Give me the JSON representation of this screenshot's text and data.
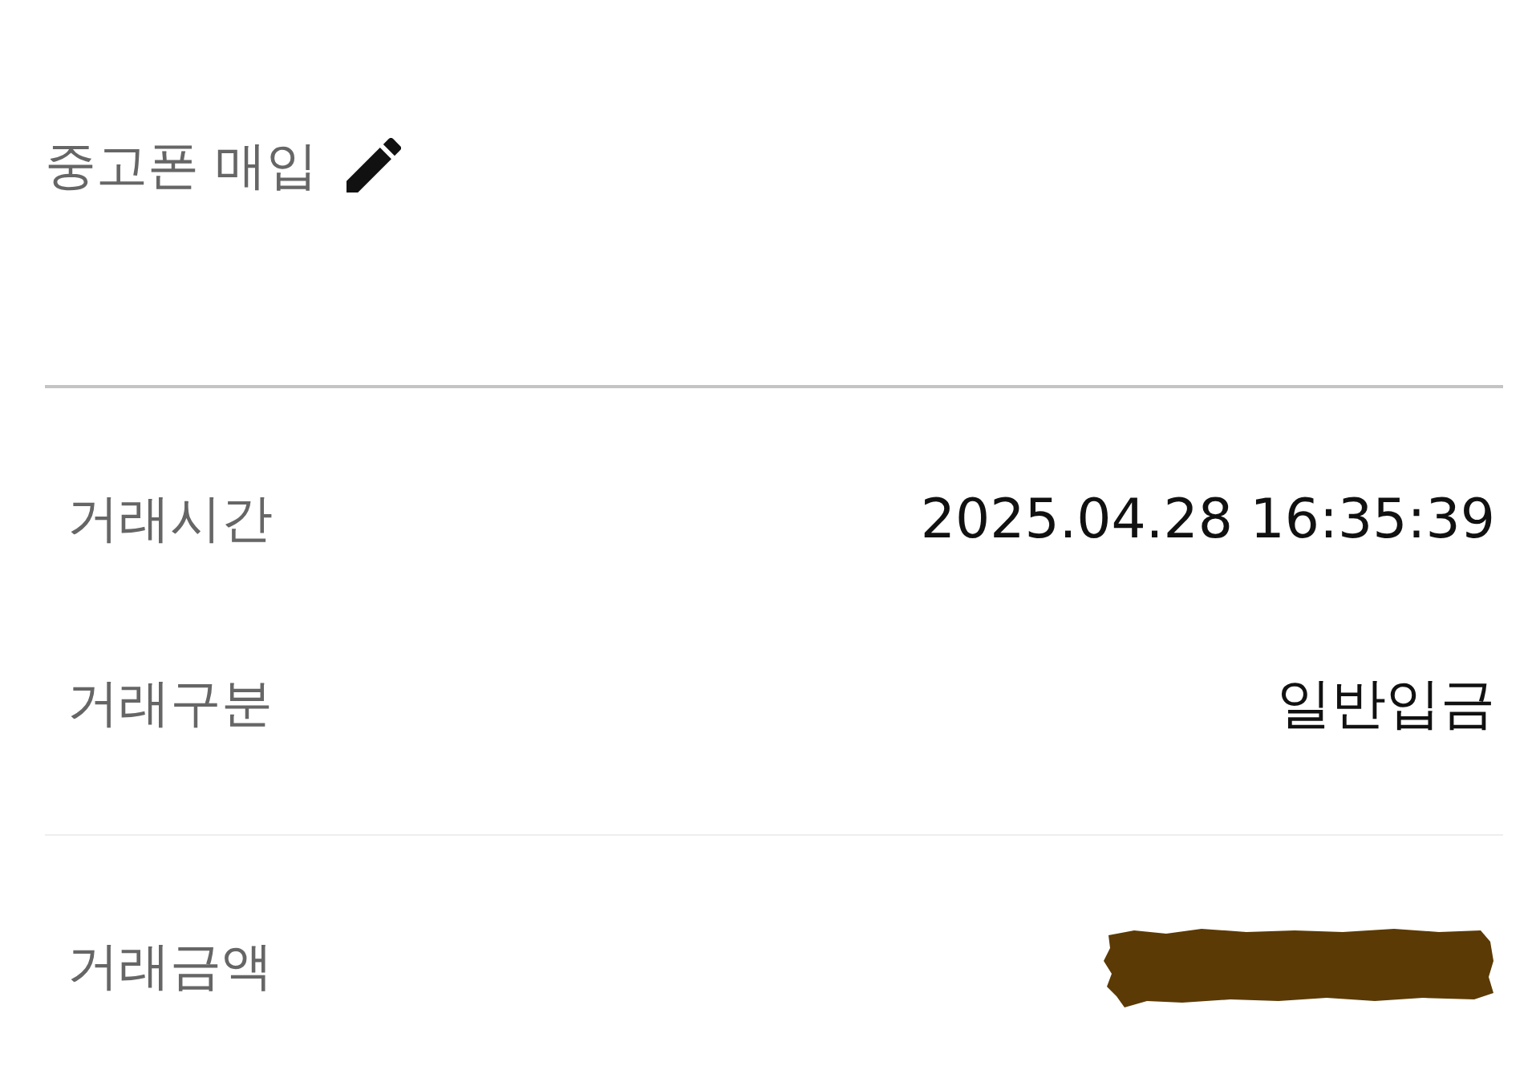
{
  "header": {
    "title": "중고폰 매입"
  },
  "sections": [
    {
      "rows": [
        {
          "label": "거래시간",
          "value": "2025.04.28 16:35:39",
          "redacted": false
        },
        {
          "label": "거래구분",
          "value": "일반입금",
          "redacted": false
        }
      ]
    },
    {
      "rows": [
        {
          "label": "거래금액",
          "redacted": true
        }
      ]
    }
  ]
}
